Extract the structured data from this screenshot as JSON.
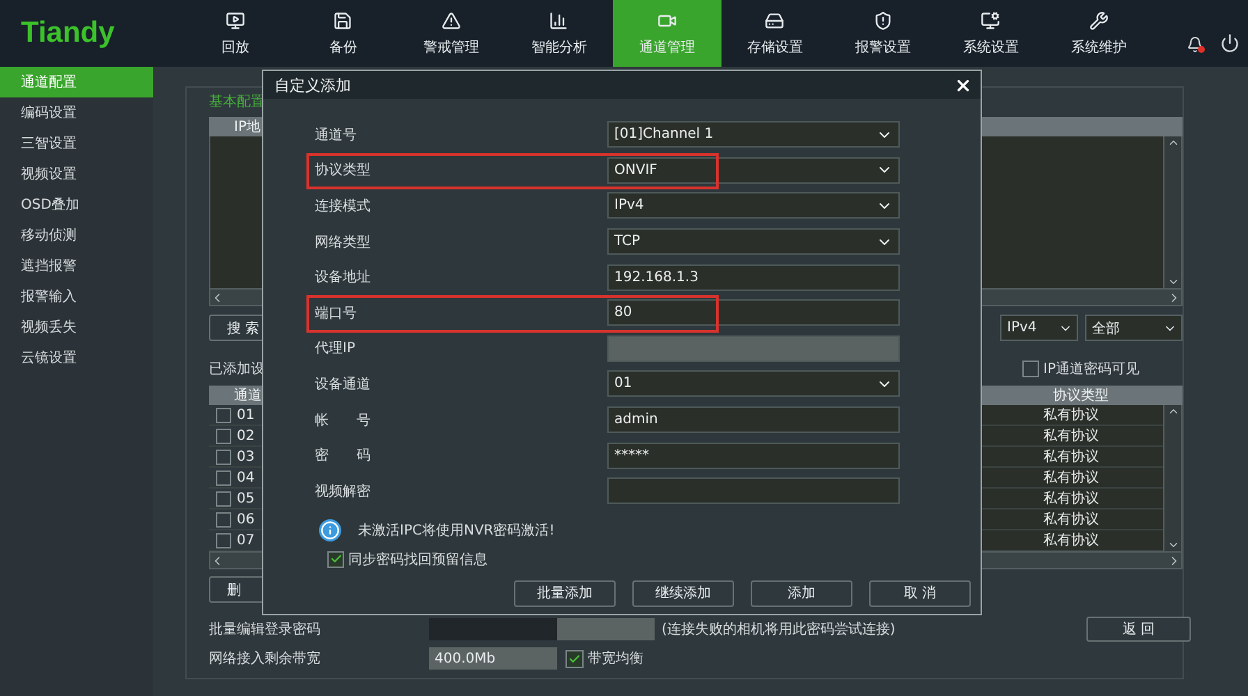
{
  "header": {
    "logo": "Tiandy",
    "nav": [
      {
        "label": "回放",
        "selected": false
      },
      {
        "label": "备份",
        "selected": false
      },
      {
        "label": "警戒管理",
        "selected": false
      },
      {
        "label": "智能分析",
        "selected": false
      },
      {
        "label": "通道管理",
        "selected": true
      },
      {
        "label": "存储设置",
        "selected": false
      },
      {
        "label": "报警设置",
        "selected": false
      },
      {
        "label": "系统设置",
        "selected": false
      },
      {
        "label": "系统维护",
        "selected": false
      }
    ]
  },
  "sidebar": {
    "items": [
      {
        "label": "通道配置",
        "selected": true
      },
      {
        "label": "编码设置",
        "selected": false
      },
      {
        "label": "三智设置",
        "selected": false
      },
      {
        "label": "视频设置",
        "selected": false
      },
      {
        "label": "OSD叠加",
        "selected": false
      },
      {
        "label": "移动侦测",
        "selected": false
      },
      {
        "label": "遮挡报警",
        "selected": false
      },
      {
        "label": "报警输入",
        "selected": false
      },
      {
        "label": "视频丢失",
        "selected": false
      },
      {
        "label": "云镜设置",
        "selected": false
      }
    ]
  },
  "panel": {
    "title": "基本配置",
    "search_table": {
      "column_1": "IP地"
    },
    "search_button": "搜 索",
    "ip_version": "IPv4",
    "filter": "全部",
    "added_label": "已添加设",
    "show_password": {
      "label": "IP通道密码可见",
      "checked": false
    },
    "added_table": {
      "columns": [
        "通道",
        "协议类型"
      ],
      "rows": [
        {
          "channel": "01",
          "checked": false,
          "protocol": "私有协议"
        },
        {
          "channel": "02",
          "checked": false,
          "protocol": "私有协议"
        },
        {
          "channel": "03",
          "checked": false,
          "protocol": "私有协议"
        },
        {
          "channel": "04",
          "checked": false,
          "protocol": "私有协议"
        },
        {
          "channel": "05",
          "checked": false,
          "protocol": "私有协议"
        },
        {
          "channel": "06",
          "checked": false,
          "protocol": "私有协议"
        },
        {
          "channel": "07",
          "checked": false,
          "protocol": "私有协议"
        }
      ]
    },
    "delete_button": "删",
    "batch_password_label": "批量编辑登录密码",
    "batch_password_hint": "(连接失败的相机将用此密码尝试连接)",
    "bandwidth_label": "网络接入剩余带宽",
    "bandwidth_value": "400.0Mb",
    "balance": {
      "label": "带宽均衡",
      "checked": true
    },
    "back_button": "返 回"
  },
  "dialog": {
    "title": "自定义添加",
    "fields": [
      {
        "label": "通道号",
        "kind": "select",
        "value": "[01]Channel 1",
        "highlighted": false
      },
      {
        "label": "协议类型",
        "kind": "select",
        "value": "ONVIF",
        "highlighted": true
      },
      {
        "label": "连接模式",
        "kind": "select",
        "value": "IPv4",
        "highlighted": false
      },
      {
        "label": "网络类型",
        "kind": "select",
        "value": "TCP",
        "highlighted": false
      },
      {
        "label": "设备地址",
        "kind": "input",
        "value": "192.168.1.3",
        "highlighted": false
      },
      {
        "label": "端口号",
        "kind": "input",
        "value": "80",
        "highlighted": true
      },
      {
        "label": "代理IP",
        "kind": "disabled",
        "highlighted": false
      },
      {
        "label": "设备通道",
        "kind": "select",
        "value": "01",
        "highlighted": false
      },
      {
        "label": "帐　　号",
        "kind": "input",
        "value": "admin",
        "highlighted": false
      },
      {
        "label": "密　　码",
        "kind": "input",
        "value": "*****",
        "highlighted": false
      },
      {
        "label": "视频解密",
        "kind": "input",
        "highlighted": false
      }
    ],
    "notice": "未激活IPC将使用NVR密码激活!",
    "sync": {
      "label": "同步密码找回预留信息",
      "checked": true
    },
    "buttons": [
      "批量添加",
      "继续添加",
      "添加",
      "取 消"
    ]
  }
}
